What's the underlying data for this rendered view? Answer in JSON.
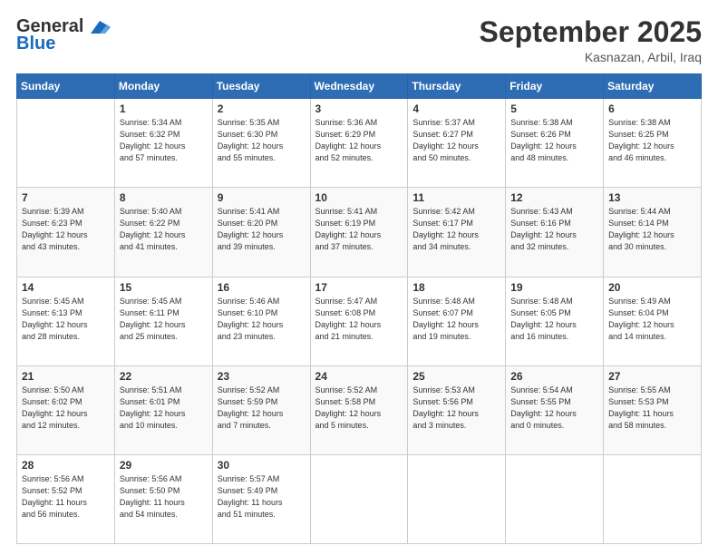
{
  "header": {
    "logo_line1": "General",
    "logo_line2": "Blue",
    "month_title": "September 2025",
    "location": "Kasnazan, Arbil, Iraq"
  },
  "weekdays": [
    "Sunday",
    "Monday",
    "Tuesday",
    "Wednesday",
    "Thursday",
    "Friday",
    "Saturday"
  ],
  "weeks": [
    [
      {
        "day": "",
        "info": ""
      },
      {
        "day": "1",
        "info": "Sunrise: 5:34 AM\nSunset: 6:32 PM\nDaylight: 12 hours\nand 57 minutes."
      },
      {
        "day": "2",
        "info": "Sunrise: 5:35 AM\nSunset: 6:30 PM\nDaylight: 12 hours\nand 55 minutes."
      },
      {
        "day": "3",
        "info": "Sunrise: 5:36 AM\nSunset: 6:29 PM\nDaylight: 12 hours\nand 52 minutes."
      },
      {
        "day": "4",
        "info": "Sunrise: 5:37 AM\nSunset: 6:27 PM\nDaylight: 12 hours\nand 50 minutes."
      },
      {
        "day": "5",
        "info": "Sunrise: 5:38 AM\nSunset: 6:26 PM\nDaylight: 12 hours\nand 48 minutes."
      },
      {
        "day": "6",
        "info": "Sunrise: 5:38 AM\nSunset: 6:25 PM\nDaylight: 12 hours\nand 46 minutes."
      }
    ],
    [
      {
        "day": "7",
        "info": "Sunrise: 5:39 AM\nSunset: 6:23 PM\nDaylight: 12 hours\nand 43 minutes."
      },
      {
        "day": "8",
        "info": "Sunrise: 5:40 AM\nSunset: 6:22 PM\nDaylight: 12 hours\nand 41 minutes."
      },
      {
        "day": "9",
        "info": "Sunrise: 5:41 AM\nSunset: 6:20 PM\nDaylight: 12 hours\nand 39 minutes."
      },
      {
        "day": "10",
        "info": "Sunrise: 5:41 AM\nSunset: 6:19 PM\nDaylight: 12 hours\nand 37 minutes."
      },
      {
        "day": "11",
        "info": "Sunrise: 5:42 AM\nSunset: 6:17 PM\nDaylight: 12 hours\nand 34 minutes."
      },
      {
        "day": "12",
        "info": "Sunrise: 5:43 AM\nSunset: 6:16 PM\nDaylight: 12 hours\nand 32 minutes."
      },
      {
        "day": "13",
        "info": "Sunrise: 5:44 AM\nSunset: 6:14 PM\nDaylight: 12 hours\nand 30 minutes."
      }
    ],
    [
      {
        "day": "14",
        "info": "Sunrise: 5:45 AM\nSunset: 6:13 PM\nDaylight: 12 hours\nand 28 minutes."
      },
      {
        "day": "15",
        "info": "Sunrise: 5:45 AM\nSunset: 6:11 PM\nDaylight: 12 hours\nand 25 minutes."
      },
      {
        "day": "16",
        "info": "Sunrise: 5:46 AM\nSunset: 6:10 PM\nDaylight: 12 hours\nand 23 minutes."
      },
      {
        "day": "17",
        "info": "Sunrise: 5:47 AM\nSunset: 6:08 PM\nDaylight: 12 hours\nand 21 minutes."
      },
      {
        "day": "18",
        "info": "Sunrise: 5:48 AM\nSunset: 6:07 PM\nDaylight: 12 hours\nand 19 minutes."
      },
      {
        "day": "19",
        "info": "Sunrise: 5:48 AM\nSunset: 6:05 PM\nDaylight: 12 hours\nand 16 minutes."
      },
      {
        "day": "20",
        "info": "Sunrise: 5:49 AM\nSunset: 6:04 PM\nDaylight: 12 hours\nand 14 minutes."
      }
    ],
    [
      {
        "day": "21",
        "info": "Sunrise: 5:50 AM\nSunset: 6:02 PM\nDaylight: 12 hours\nand 12 minutes."
      },
      {
        "day": "22",
        "info": "Sunrise: 5:51 AM\nSunset: 6:01 PM\nDaylight: 12 hours\nand 10 minutes."
      },
      {
        "day": "23",
        "info": "Sunrise: 5:52 AM\nSunset: 5:59 PM\nDaylight: 12 hours\nand 7 minutes."
      },
      {
        "day": "24",
        "info": "Sunrise: 5:52 AM\nSunset: 5:58 PM\nDaylight: 12 hours\nand 5 minutes."
      },
      {
        "day": "25",
        "info": "Sunrise: 5:53 AM\nSunset: 5:56 PM\nDaylight: 12 hours\nand 3 minutes."
      },
      {
        "day": "26",
        "info": "Sunrise: 5:54 AM\nSunset: 5:55 PM\nDaylight: 12 hours\nand 0 minutes."
      },
      {
        "day": "27",
        "info": "Sunrise: 5:55 AM\nSunset: 5:53 PM\nDaylight: 11 hours\nand 58 minutes."
      }
    ],
    [
      {
        "day": "28",
        "info": "Sunrise: 5:56 AM\nSunset: 5:52 PM\nDaylight: 11 hours\nand 56 minutes."
      },
      {
        "day": "29",
        "info": "Sunrise: 5:56 AM\nSunset: 5:50 PM\nDaylight: 11 hours\nand 54 minutes."
      },
      {
        "day": "30",
        "info": "Sunrise: 5:57 AM\nSunset: 5:49 PM\nDaylight: 11 hours\nand 51 minutes."
      },
      {
        "day": "",
        "info": ""
      },
      {
        "day": "",
        "info": ""
      },
      {
        "day": "",
        "info": ""
      },
      {
        "day": "",
        "info": ""
      }
    ]
  ]
}
